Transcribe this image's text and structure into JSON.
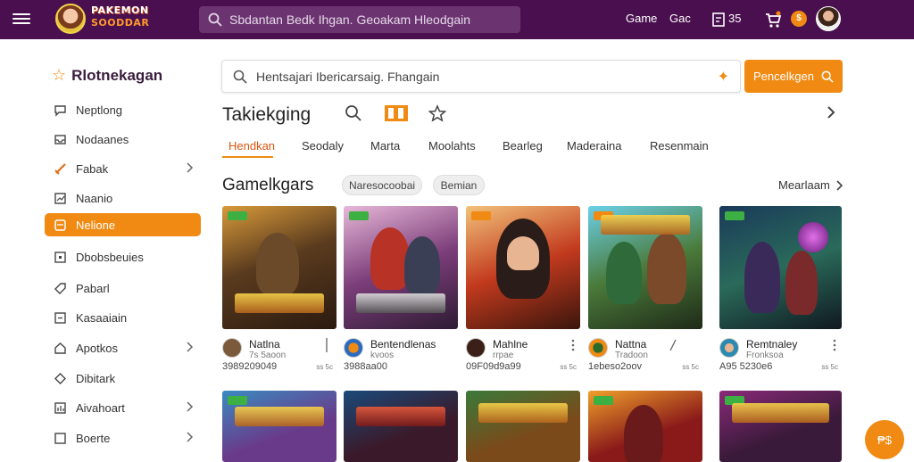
{
  "topbar": {
    "logo_line1": "PAKEMON",
    "logo_line2": "SOODDAR",
    "search_placeholder": "Sbdantan Bedk Ihgan. Geoakam Hleodgain",
    "links": [
      "Game",
      "Gac",
      "35"
    ],
    "coin_label": "$"
  },
  "sidebar": {
    "title": "Rlotnekagan",
    "items": [
      {
        "label": "Neptlong",
        "icon": "chat-icon",
        "chevron": false,
        "active": false
      },
      {
        "label": "Nodaanes",
        "icon": "inbox-icon",
        "chevron": false,
        "active": false
      },
      {
        "label": "Fabak",
        "icon": "sword-icon",
        "chevron": true,
        "active": false
      },
      {
        "label": "Naanio",
        "icon": "chart-icon",
        "chevron": false,
        "active": false
      },
      {
        "label": "Nelione",
        "icon": "card-icon",
        "chevron": false,
        "active": true
      },
      {
        "label": "Dbobsbeuies",
        "icon": "box-icon",
        "chevron": false,
        "active": false
      },
      {
        "label": "Pabarl",
        "icon": "tag-icon",
        "chevron": false,
        "active": false
      },
      {
        "label": "Kasaaiain",
        "icon": "list-icon",
        "chevron": false,
        "active": false
      },
      {
        "label": "Apotkos",
        "icon": "home-icon",
        "chevron": true,
        "active": false
      },
      {
        "label": "Dibitark",
        "icon": "diamond-icon",
        "chevron": false,
        "active": false
      },
      {
        "label": "Aivahoart",
        "icon": "stats-icon",
        "chevron": true,
        "active": false
      },
      {
        "label": "Boerte",
        "icon": "square-icon",
        "chevron": true,
        "active": false
      }
    ]
  },
  "main": {
    "search_placeholder": "Hentsajari Ibericarsaig. Fhangain",
    "search_button": "Pencelkgen",
    "section_title": "Takiekging",
    "tabs": [
      "Hendkan",
      "Seodaly",
      "Marta",
      "Moolahts",
      "Bearleg",
      "Maderaina",
      "Resenmain"
    ],
    "games_title": "Gamelkgars",
    "chips": [
      "Naresocoobai",
      "Bemian"
    ],
    "more_label": "Mearlaam"
  },
  "cards_row1": [
    {
      "name": "Natlna",
      "sub": "7s 5aoon",
      "num": "3989209049",
      "ext": "ss 5c"
    },
    {
      "name": "Bentendlenas",
      "sub": "kvoos",
      "num": "3988aa00",
      "ext": ""
    },
    {
      "name": "Mahlne",
      "sub": "rrpae",
      "num": "09F09d9a99",
      "ext": "ss 5c"
    },
    {
      "name": "Nattna",
      "sub": "Tradoon",
      "num": "1ebeso2oov",
      "ext": "ss 5c"
    },
    {
      "name": "Remtnaley",
      "sub": "Fronksoa",
      "num": "A95 5230e6",
      "ext": "ss 5c"
    }
  ],
  "fab_label": "₱$"
}
